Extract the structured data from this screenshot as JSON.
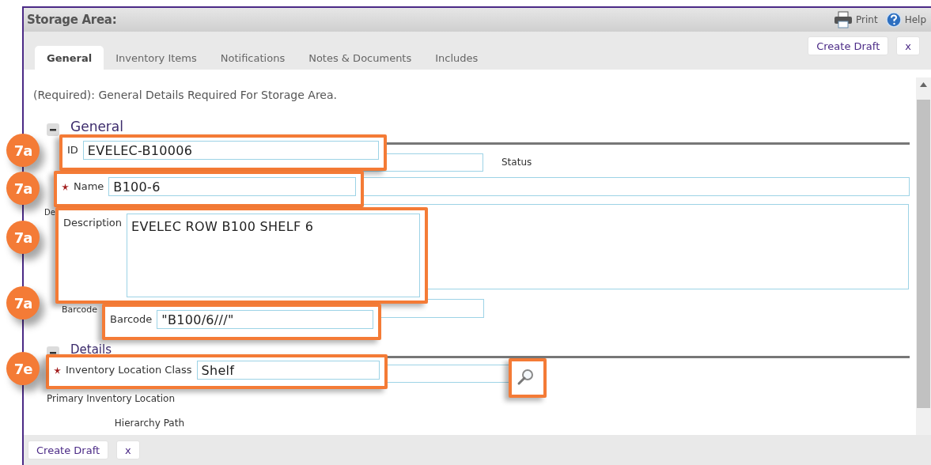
{
  "header": {
    "title": "Storage Area:",
    "actions": [
      {
        "kind": "print",
        "label": "Print"
      },
      {
        "kind": "help",
        "label": "Help"
      }
    ]
  },
  "tabs": [
    {
      "label": "General",
      "selected": true
    },
    {
      "label": "Inventory Items",
      "selected": false
    },
    {
      "label": "Notifications",
      "selected": false
    },
    {
      "label": "Notes & Documents",
      "selected": false
    },
    {
      "label": "Includes",
      "selected": false
    }
  ],
  "top_buttons": [
    "Create Draft",
    "x"
  ],
  "required_note": "(Required): General Details Required For Storage Area.",
  "sections": [
    {
      "title": "General",
      "expanded": true
    },
    {
      "title": "Details",
      "expanded": true
    }
  ],
  "general": {
    "status_label": "Status",
    "description_label": "De",
    "barcode_label": "Barcode"
  },
  "details": {
    "primary_location_label": "Primary Inventory Location",
    "hierarchy_path_label": "Hierarchy Path"
  },
  "callouts": [
    {
      "badge": "7a",
      "kind": "field",
      "label": "ID",
      "value": "EVELEC-B10006",
      "required": false
    },
    {
      "badge": "7a",
      "kind": "field",
      "label": "Name",
      "value": "B100-6",
      "required": true
    },
    {
      "badge": "7a",
      "kind": "textarea",
      "label": "Description",
      "value": "EVELEC ROW B100 SHELF 6",
      "required": false
    },
    {
      "badge": "7a",
      "kind": "field",
      "label": "Barcode",
      "value": "\"B100/6///\"",
      "required": false
    },
    {
      "badge": "7e",
      "kind": "field",
      "label": "Inventory Location Class",
      "value": "Shelf",
      "required": true
    },
    {
      "kind": "lookup"
    }
  ],
  "bottom_buttons": [
    "Create Draft",
    "x"
  ]
}
